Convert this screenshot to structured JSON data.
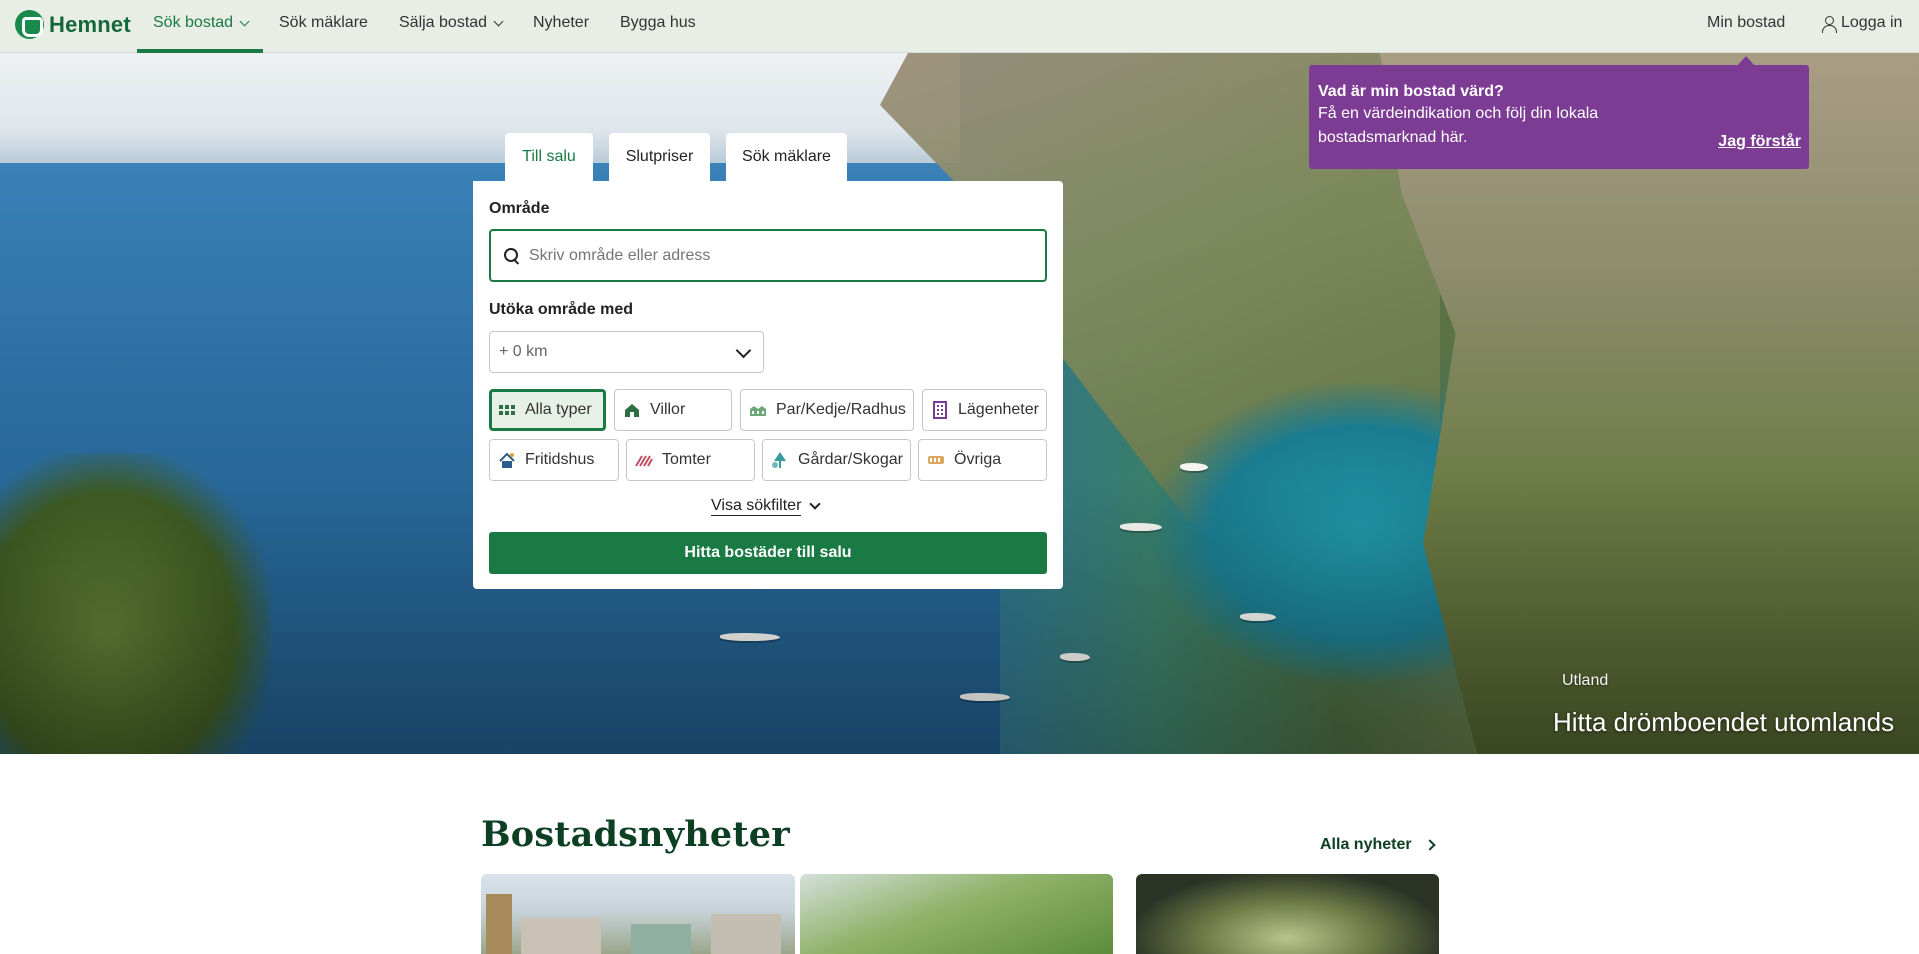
{
  "nav": {
    "logo": "Hemnet",
    "items": [
      {
        "label": "Sök bostad",
        "dropdown": true,
        "active": true
      },
      {
        "label": "Sök mäklare",
        "dropdown": false
      },
      {
        "label": "Sälja bostad",
        "dropdown": true
      },
      {
        "label": "Nyheter",
        "dropdown": false
      },
      {
        "label": "Bygga hus",
        "dropdown": false
      }
    ],
    "my_home": "Min bostad",
    "login": "Logga in"
  },
  "tooltip": {
    "title": "Vad är min bostad värd?",
    "body": "Få en värdeindikation och följ din lokala bostadsmarknad här.",
    "button": "Jag förstår"
  },
  "search": {
    "tabs": [
      "Till salu",
      "Slutpriser",
      "Sök mäklare"
    ],
    "area_label": "Område",
    "area_placeholder": "Skriv område eller adress",
    "extend_label": "Utöka område med",
    "extend_value": "+ 0 km",
    "types": [
      {
        "label": "Alla typer",
        "icon": "grid-icon",
        "active": true
      },
      {
        "label": "Villor",
        "icon": "house-icon"
      },
      {
        "label": "Par/Kedje/Radhus",
        "icon": "rowhouse-icon"
      },
      {
        "label": "Lägenheter",
        "icon": "apartment-icon"
      },
      {
        "label": "Fritidshus",
        "icon": "cottage-icon"
      },
      {
        "label": "Tomter",
        "icon": "plot-icon"
      },
      {
        "label": "Gårdar/Skogar",
        "icon": "tree-icon"
      },
      {
        "label": "Övriga",
        "icon": "other-icon"
      }
    ],
    "filters_link": "Visa sökfilter",
    "cta": "Hitta bostäder till salu"
  },
  "hero": {
    "caption_small": "Utland",
    "caption_big": "Hitta drömboendet utomlands"
  },
  "news": {
    "title": "Bostadsnyheter",
    "all_link": "Alla nyheter"
  },
  "colors": {
    "brand_green": "#1a7a44",
    "tooltip_purple": "#7d3c93",
    "nav_bg": "#e8eee6"
  }
}
